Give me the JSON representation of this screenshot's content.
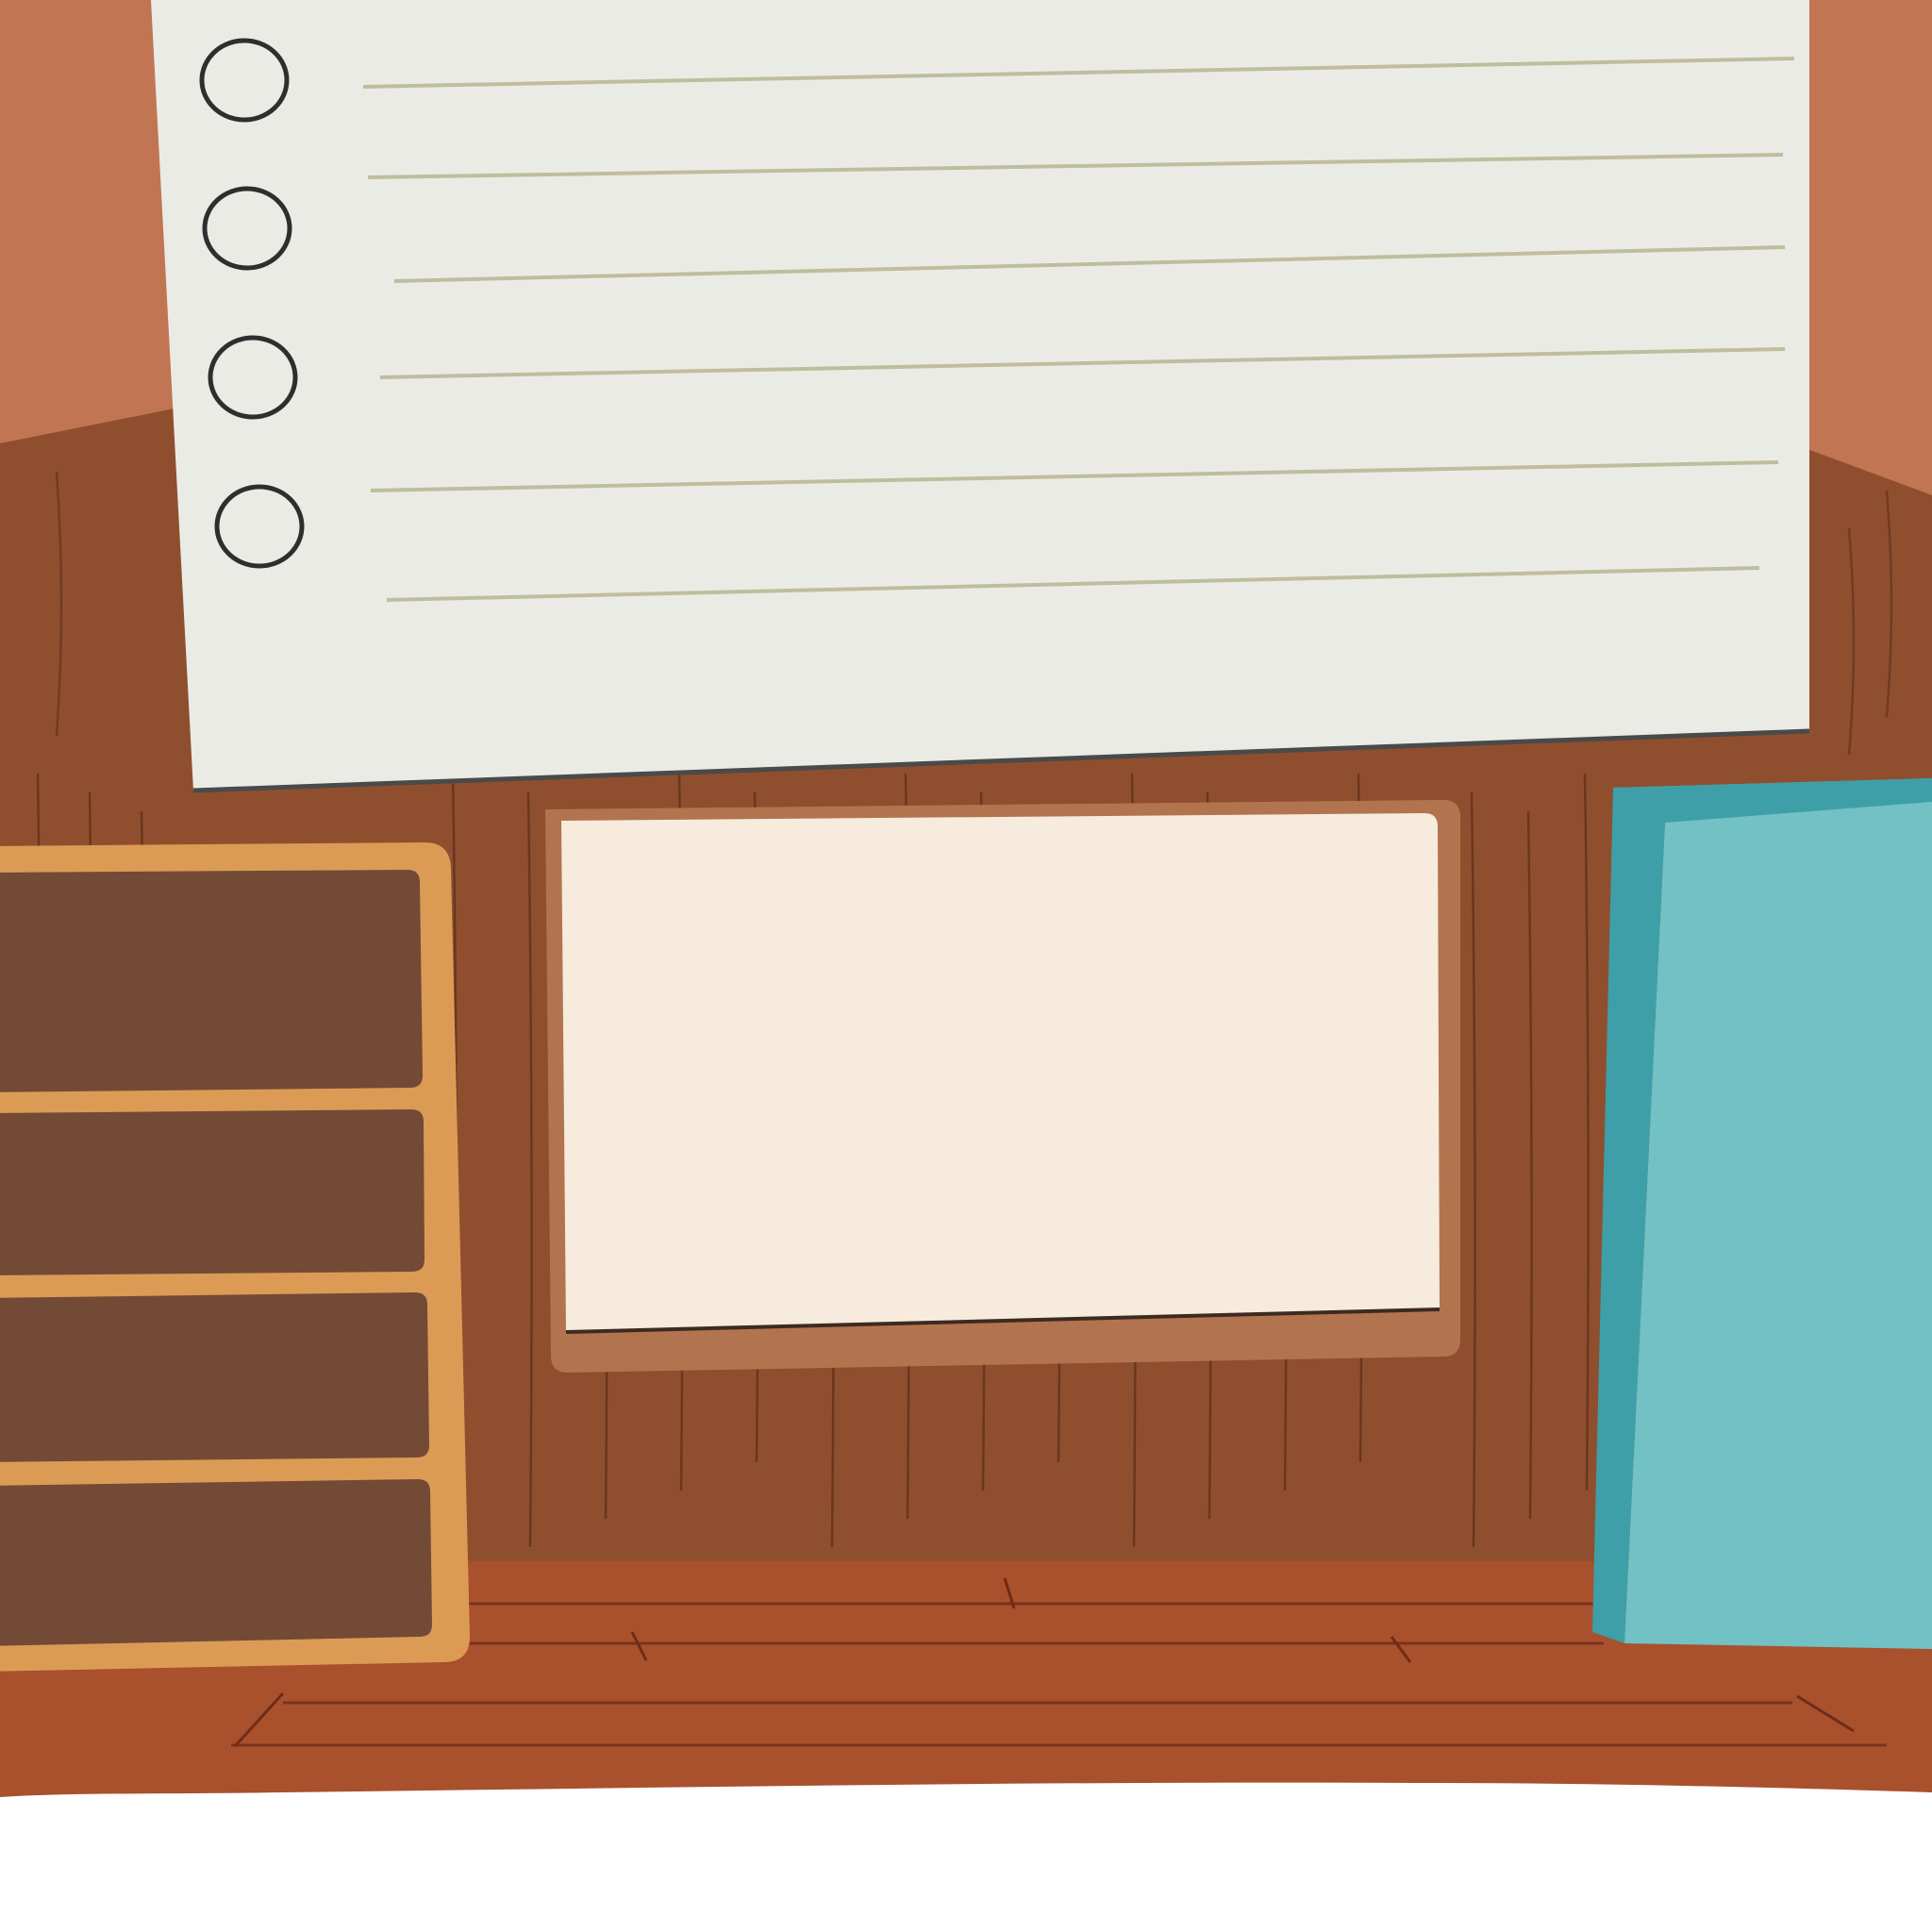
{
  "scene": {
    "description_label": "",
    "colors": {
      "wall": "#c17553",
      "wood_panel": "#8f4f2f",
      "wood_grain": "#5e2d1a",
      "desk": "#a9502d",
      "desk_line": "#6f2c17",
      "paper": "#ebebe6",
      "paper_line": "#bfbd9c",
      "ring": "#2f2d2d",
      "drawer_frame": "#dc9b55",
      "drawer": "#734a36",
      "card_frame": "#b2744f",
      "card": "#f6ebdd",
      "book": "#72c1c4",
      "book_spine": "#3e9fa8",
      "background": "#ffffff"
    }
  },
  "notebook_paper": {
    "ring_holes": 4,
    "ruled_lines": 6
  },
  "drawer_unit": {
    "drawers": 4
  }
}
